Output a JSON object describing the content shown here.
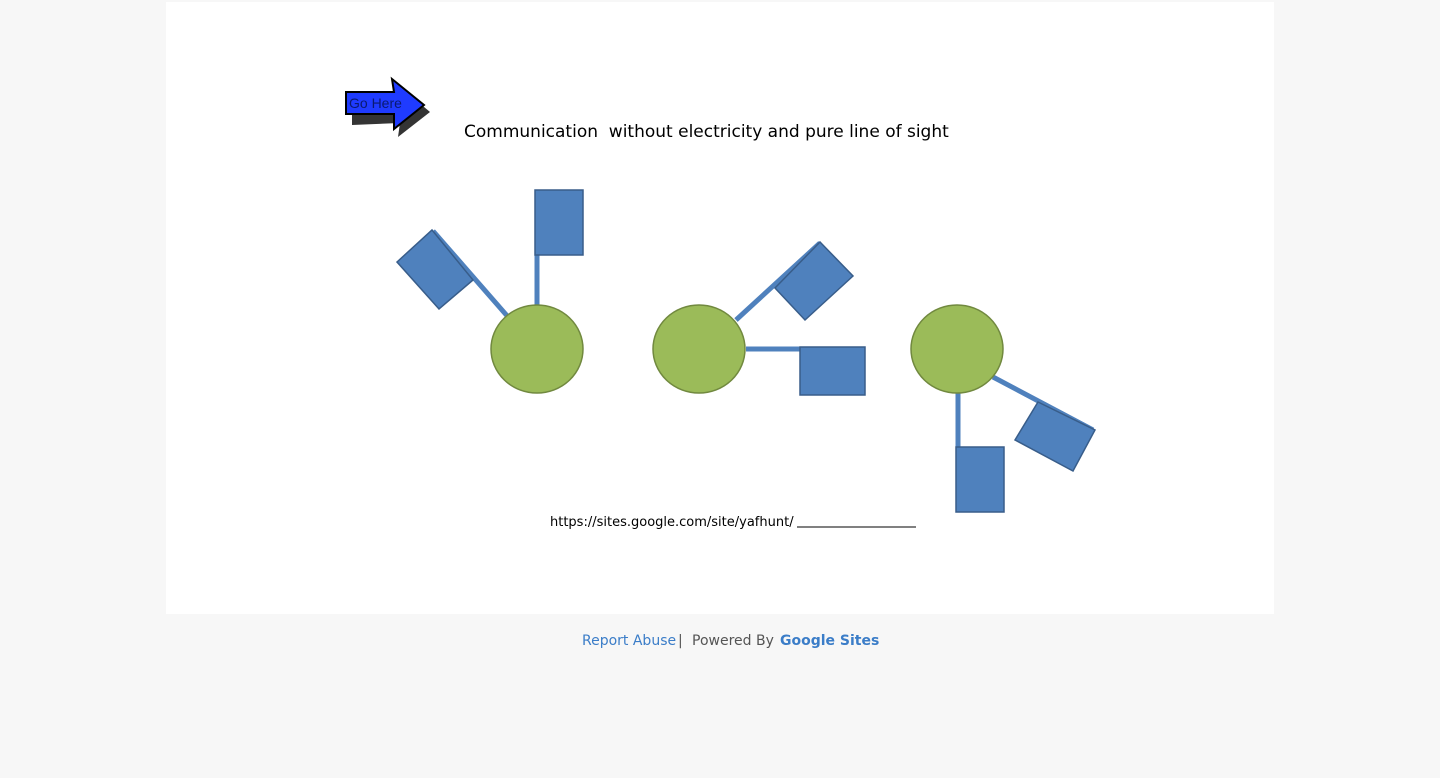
{
  "header": {
    "go_here_label": "Go Here",
    "title": "Communication  without electricity and pure line of sight"
  },
  "diagram": {
    "url_text": "https://sites.google.com/site/yafhunt/",
    "colors": {
      "circle_fill": "#9bbb59",
      "circle_stroke": "#71893f",
      "flag_fill": "#4f81bd",
      "flag_stroke": "#385d8a",
      "pole": "#4f81bd",
      "arrow_fill": "#1f3bff"
    }
  },
  "footer": {
    "report_abuse": "Report Abuse",
    "separator": "|",
    "powered_by": "Powered By",
    "google_sites": "Google Sites"
  }
}
